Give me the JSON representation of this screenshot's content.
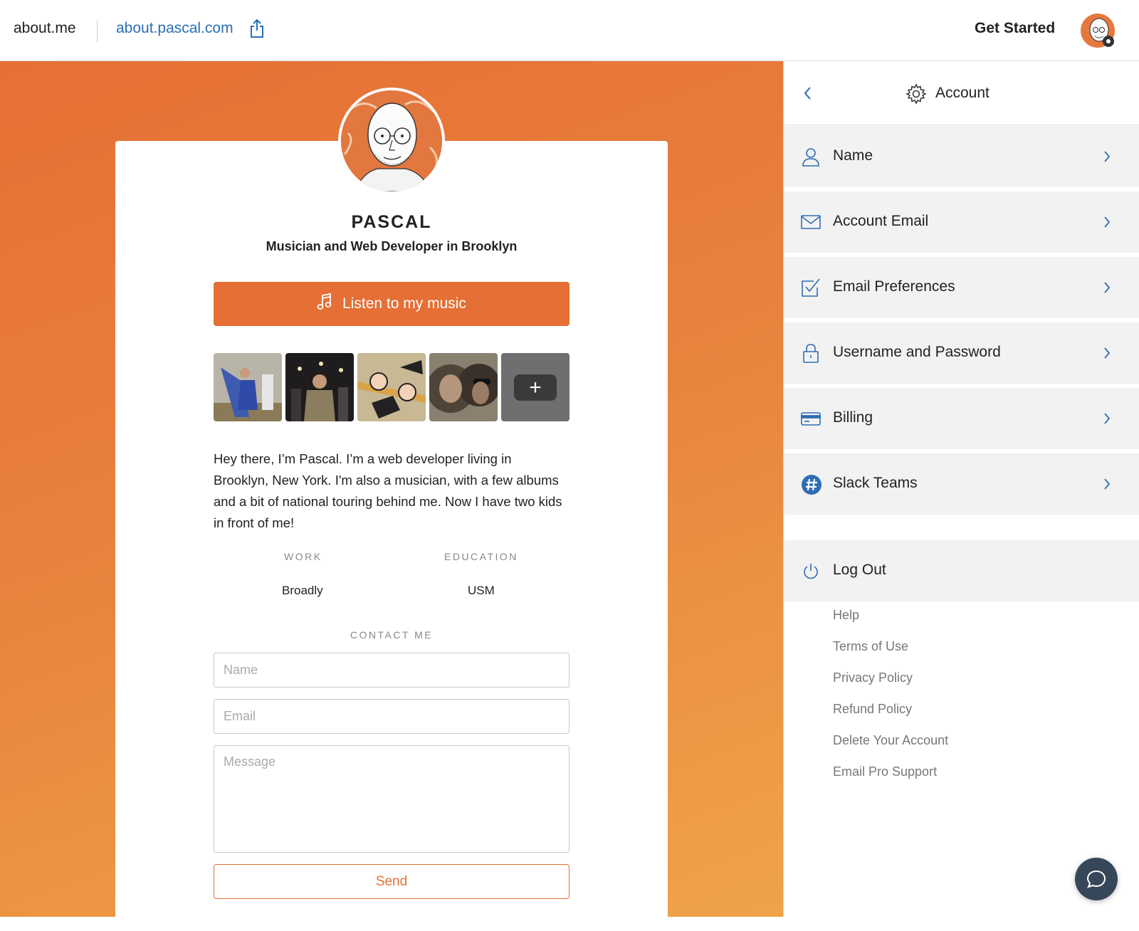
{
  "topbar": {
    "brand": "about.me",
    "site_url": "about.pascal.com",
    "cta": "Get Started"
  },
  "profile": {
    "name": "PASCAL",
    "headline": "Musician and Web Developer in Brooklyn",
    "listen_button": "Listen to my music",
    "bio": "Hey there, I’m Pascal. I’m a web developer living in Brooklyn, New York. I'm also a musician, with a few albums and a bit of national touring behind me. Now I have two kids in front of me!",
    "work_label": "WORK",
    "work_value": "Broadly",
    "education_label": "EDUCATION",
    "education_value": "USM",
    "contact_label": "CONTACT ME",
    "contact_name_placeholder": "Name",
    "contact_email_placeholder": "Email",
    "contact_message_placeholder": "Message",
    "send_button": "Send"
  },
  "panel": {
    "title": "Account",
    "items": [
      {
        "label": "Name",
        "icon": "user-icon"
      },
      {
        "label": "Account Email",
        "icon": "envelope-icon"
      },
      {
        "label": "Email Preferences",
        "icon": "checkbox-icon"
      },
      {
        "label": "Username and Password",
        "icon": "lock-icon"
      },
      {
        "label": "Billing",
        "icon": "credit-card-icon"
      },
      {
        "label": "Slack Teams",
        "icon": "slack-hash-icon"
      }
    ],
    "logout": "Log Out",
    "footer_links": [
      "Help",
      "Terms of Use",
      "Privacy Policy",
      "Refund Policy",
      "Delete Your Account",
      "Email Pro Support"
    ]
  },
  "colors": {
    "accent_orange": "#e56f35",
    "link_blue": "#2a6fb8",
    "icon_blue": "#2f6db3",
    "chat_bg": "#37475a"
  }
}
